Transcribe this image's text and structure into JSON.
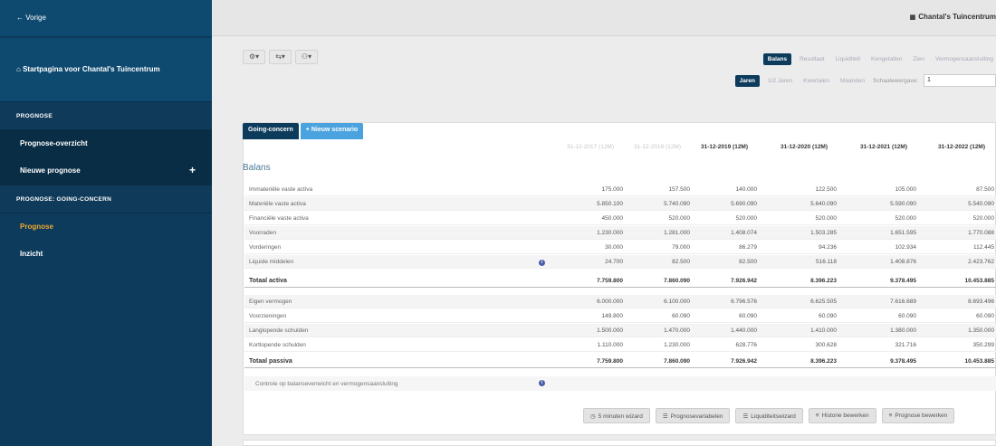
{
  "sidebar": {
    "back": "← Vorige",
    "home": "Startpagina voor Chantal's Tuincentrum",
    "section_prognose": "PROGNOSE",
    "items_prognose": [
      "Prognose-overzicht",
      "Nieuwe prognose"
    ],
    "plus": "+",
    "section_scenario": "PROGNOSE: GOING-CONCERN",
    "items_scenario": [
      "Prognose",
      "Inzicht"
    ]
  },
  "topbar": {
    "company": "Chantal's Tuincentrum",
    "company_icon": "building-icon"
  },
  "toolbar": {
    "settings": "⚙▾",
    "transfer": "⇆▾",
    "people": "⚇▾"
  },
  "tabs_view": [
    "Balans",
    "Resultaat",
    "Liquiditeit",
    "Kengetallen",
    "Zien",
    "Vermogensaansluiting"
  ],
  "tabs_period": [
    "Jaren",
    "1/2 Jaren",
    "Kwartalen",
    "Maanden"
  ],
  "schedule": {
    "label": "Schaalweergave:",
    "value": "1"
  },
  "scenario": {
    "current": "Going-concern",
    "new": "Nieuw scenario"
  },
  "columns": [
    "31-12-2017 (12M)",
    "31-12-2018 (12M)",
    "31-12-2019 (12M)",
    "31-12-2020 (12M)",
    "31-12-2021 (12M)",
    "31-12-2022 (12M)"
  ],
  "section_title": "Balans",
  "rows": [
    {
      "label": "Immateriële vaste activa",
      "values": [
        "175.000",
        "157.500",
        "140.000",
        "122.500",
        "105.000",
        "87.500"
      ]
    },
    {
      "label": "Materiële vaste activa",
      "values": [
        "5.850.100",
        "5.740.090",
        "5.690.090",
        "5.640.090",
        "5.590.090",
        "5.540.090"
      ]
    },
    {
      "label": "Financiële vaste activa",
      "values": [
        "450.000",
        "520.000",
        "520.000",
        "520.000",
        "520.000",
        "520.000"
      ]
    },
    {
      "label": "Voorraden",
      "values": [
        "1.230.000",
        "1.281.000",
        "1.408.074",
        "1.503.285",
        "1.651.595",
        "1.770.088"
      ]
    },
    {
      "label": "Vorderingen",
      "values": [
        "30.000",
        "79.000",
        "86.279",
        "94.236",
        "102.934",
        "112.445"
      ]
    },
    {
      "label": "Liquide middelen",
      "values": [
        "24.700",
        "82.500",
        "82.500",
        "516.118",
        "1.408.876",
        "2.423.762"
      ],
      "info": true
    },
    {
      "label": "Totaal activa",
      "values": [
        "7.759.800",
        "7.860.090",
        "7.926.942",
        "8.396.223",
        "9.378.495",
        "10.453.885"
      ],
      "total": true
    },
    {
      "label": "Eigen vermogen",
      "values": [
        "6.000.000",
        "6.100.000",
        "6.796.576",
        "6.625.505",
        "7.616.689",
        "8.693.496"
      ]
    },
    {
      "label": "Voorzieningen",
      "values": [
        "149.800",
        "60.090",
        "60.090",
        "60.090",
        "60.090",
        "60.090"
      ]
    },
    {
      "label": "Langlopende schulden",
      "values": [
        "1.500.000",
        "1.470.000",
        "1.440.000",
        "1.410.000",
        "1.380.000",
        "1.350.000"
      ]
    },
    {
      "label": "Kortlopende schulden",
      "values": [
        "1.110.000",
        "1.230.000",
        "628.776",
        "300.628",
        "321.716",
        "350.299"
      ]
    },
    {
      "label": "Totaal passiva",
      "values": [
        "7.759.800",
        "7.860.090",
        "7.926.942",
        "8.396.223",
        "9.378.495",
        "10.453.885"
      ],
      "total": true
    }
  ],
  "control_label": "Controle op balansevenwicht en vermogensaansluiting",
  "actions": [
    {
      "icon": "clock-icon",
      "glyph": "◷",
      "label": "5 minuten wizard"
    },
    {
      "icon": "list-icon",
      "glyph": "☰",
      "label": "Prognosevariabelen"
    },
    {
      "icon": "list-icon",
      "glyph": "☰",
      "label": "Liquiditeitswizard"
    },
    {
      "icon": "filter-icon",
      "glyph": "≡",
      "label": "Historie bewerken"
    },
    {
      "icon": "filter-icon",
      "glyph": "≡",
      "label": "Prognose bewerken"
    }
  ]
}
